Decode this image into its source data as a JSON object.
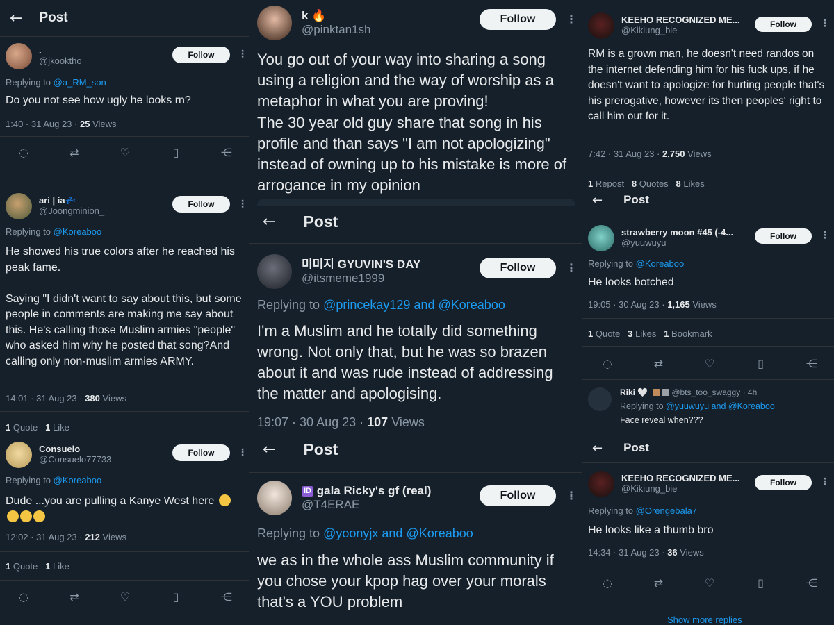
{
  "colors": {
    "bg": "#15202b",
    "text": "#e7e9ea",
    "muted": "#8b98a5",
    "link": "#1d9bf0",
    "follow_bg": "#eff3f4"
  },
  "common": {
    "back_icon": "←",
    "post_title": "Post",
    "follow_label": "Follow",
    "more_icon": "⋮",
    "replying_prefix": "Replying to",
    "and": "and",
    "views_word": "Views"
  },
  "left": {
    "t1": {
      "name": ".",
      "handle": "@jkooktho",
      "reply_to": "@a_RM_son",
      "text": "Do you not see how ugly he looks rn?",
      "time": "1:40 · 31 Aug 23 · ",
      "views": "25"
    },
    "t2": {
      "name": "ari | ia💤",
      "handle": "@Joongminion_",
      "reply_to": "@Koreaboo",
      "text": "He showed his true colors after he reached his peak fame.\n\nSaying \"I didn't want to say about this, but some people in comments are making me say about this. He's calling those Muslim armies \"people\" who asked him why he posted that song?And calling only non-muslim armies ARMY.",
      "time": "14:01 · 31 Aug 23 · ",
      "views": "380",
      "quotes": "1",
      "quotes_label": "Quote",
      "likes": "1",
      "likes_label": "Like"
    },
    "t3": {
      "name": "Consuelo",
      "handle": "@Consuelo77733",
      "reply_to": "@Koreaboo",
      "text": "Dude ...you are pulling a Kanye West here",
      "time": "12:02 · 31 Aug 23 · ",
      "views": "212",
      "quotes": "1",
      "quotes_label": "Quote",
      "likes": "1",
      "likes_label": "Like"
    }
  },
  "mid": {
    "t1": {
      "name": "k",
      "handle": "@pinktan1sh",
      "text": "You go out of your way into sharing a song using a religion and the way of worship as a metaphor in what you are proving!\nThe 30 year old guy share that song in his profile and than says \"I am not apologizing\" instead of owning up to his mistake is more of arrogance in my opinion"
    },
    "t2": {
      "name": "미미지 GYUVIN'S DAY",
      "handle": "@itsmeme1999",
      "reply_to_a": "@princekay129",
      "reply_to_b": "@Koreaboo",
      "text": "I'm a Muslim and he totally did something wrong. Not only that, but he was so brazen about it and was rude instead of addressing the matter and apologising.",
      "time": "19:07 · 30 Aug 23 · ",
      "views": "107"
    },
    "t3": {
      "badge": "ID",
      "name": "gala Ricky's gf (real)",
      "handle": "@T4ERAE",
      "reply_to_a": "@yoonyjx",
      "reply_to_b": "@Koreaboo",
      "text": "we as in the whole ass Muslim community if you chose your kpop hag over your morals that's a YOU problem"
    }
  },
  "right": {
    "t1": {
      "name": "KEEHO RECOGNIZED ME...",
      "handle": "@Kikiung_bie",
      "text": "RM is a grown man, he doesn't need randos on the internet defending him for his fuck ups, if he doesn't want to apologize for hurting people that's his prerogative, however its then peoples' right to call him out for it.",
      "time": "7:42 · 31 Aug 23 · ",
      "views": "2,750",
      "reposts": "1",
      "reposts_label": "Repost",
      "quotes": "8",
      "quotes_label": "Quotes",
      "likes": "8",
      "likes_label": "Likes"
    },
    "t2": {
      "name": "strawberry moon #45 (-4...",
      "handle": "@yuuwuyu",
      "reply_to": "@Koreaboo",
      "text": "He looks botched",
      "time": "19:05 · 30 Aug 23 · ",
      "views": "1,165",
      "quotes": "1",
      "quotes_label": "Quote",
      "likes": "3",
      "likes_label": "Likes",
      "bookmarks": "1",
      "bookmarks_label": "Bookmark"
    },
    "t2reply": {
      "name": "Riki 🤍",
      "handle": "@bts_too_swaggy · 4h",
      "reply_to_a": "@yuuwuyu",
      "reply_to_b": "@Koreaboo",
      "text": "Face reveal when???"
    },
    "t3": {
      "name": "KEEHO RECOGNIZED ME...",
      "handle": "@Kikiung_bie",
      "reply_to": "@Orengebala7",
      "text": "He looks like a thumb bro",
      "time": "14:34 · 31 Aug 23 · ",
      "views": "36"
    },
    "show_more": "Show more replies"
  },
  "icons": {
    "reply": "reply-icon",
    "repost": "repost-icon",
    "like": "heart-icon",
    "bookmark": "bookmark-icon",
    "share": "share-icon"
  }
}
